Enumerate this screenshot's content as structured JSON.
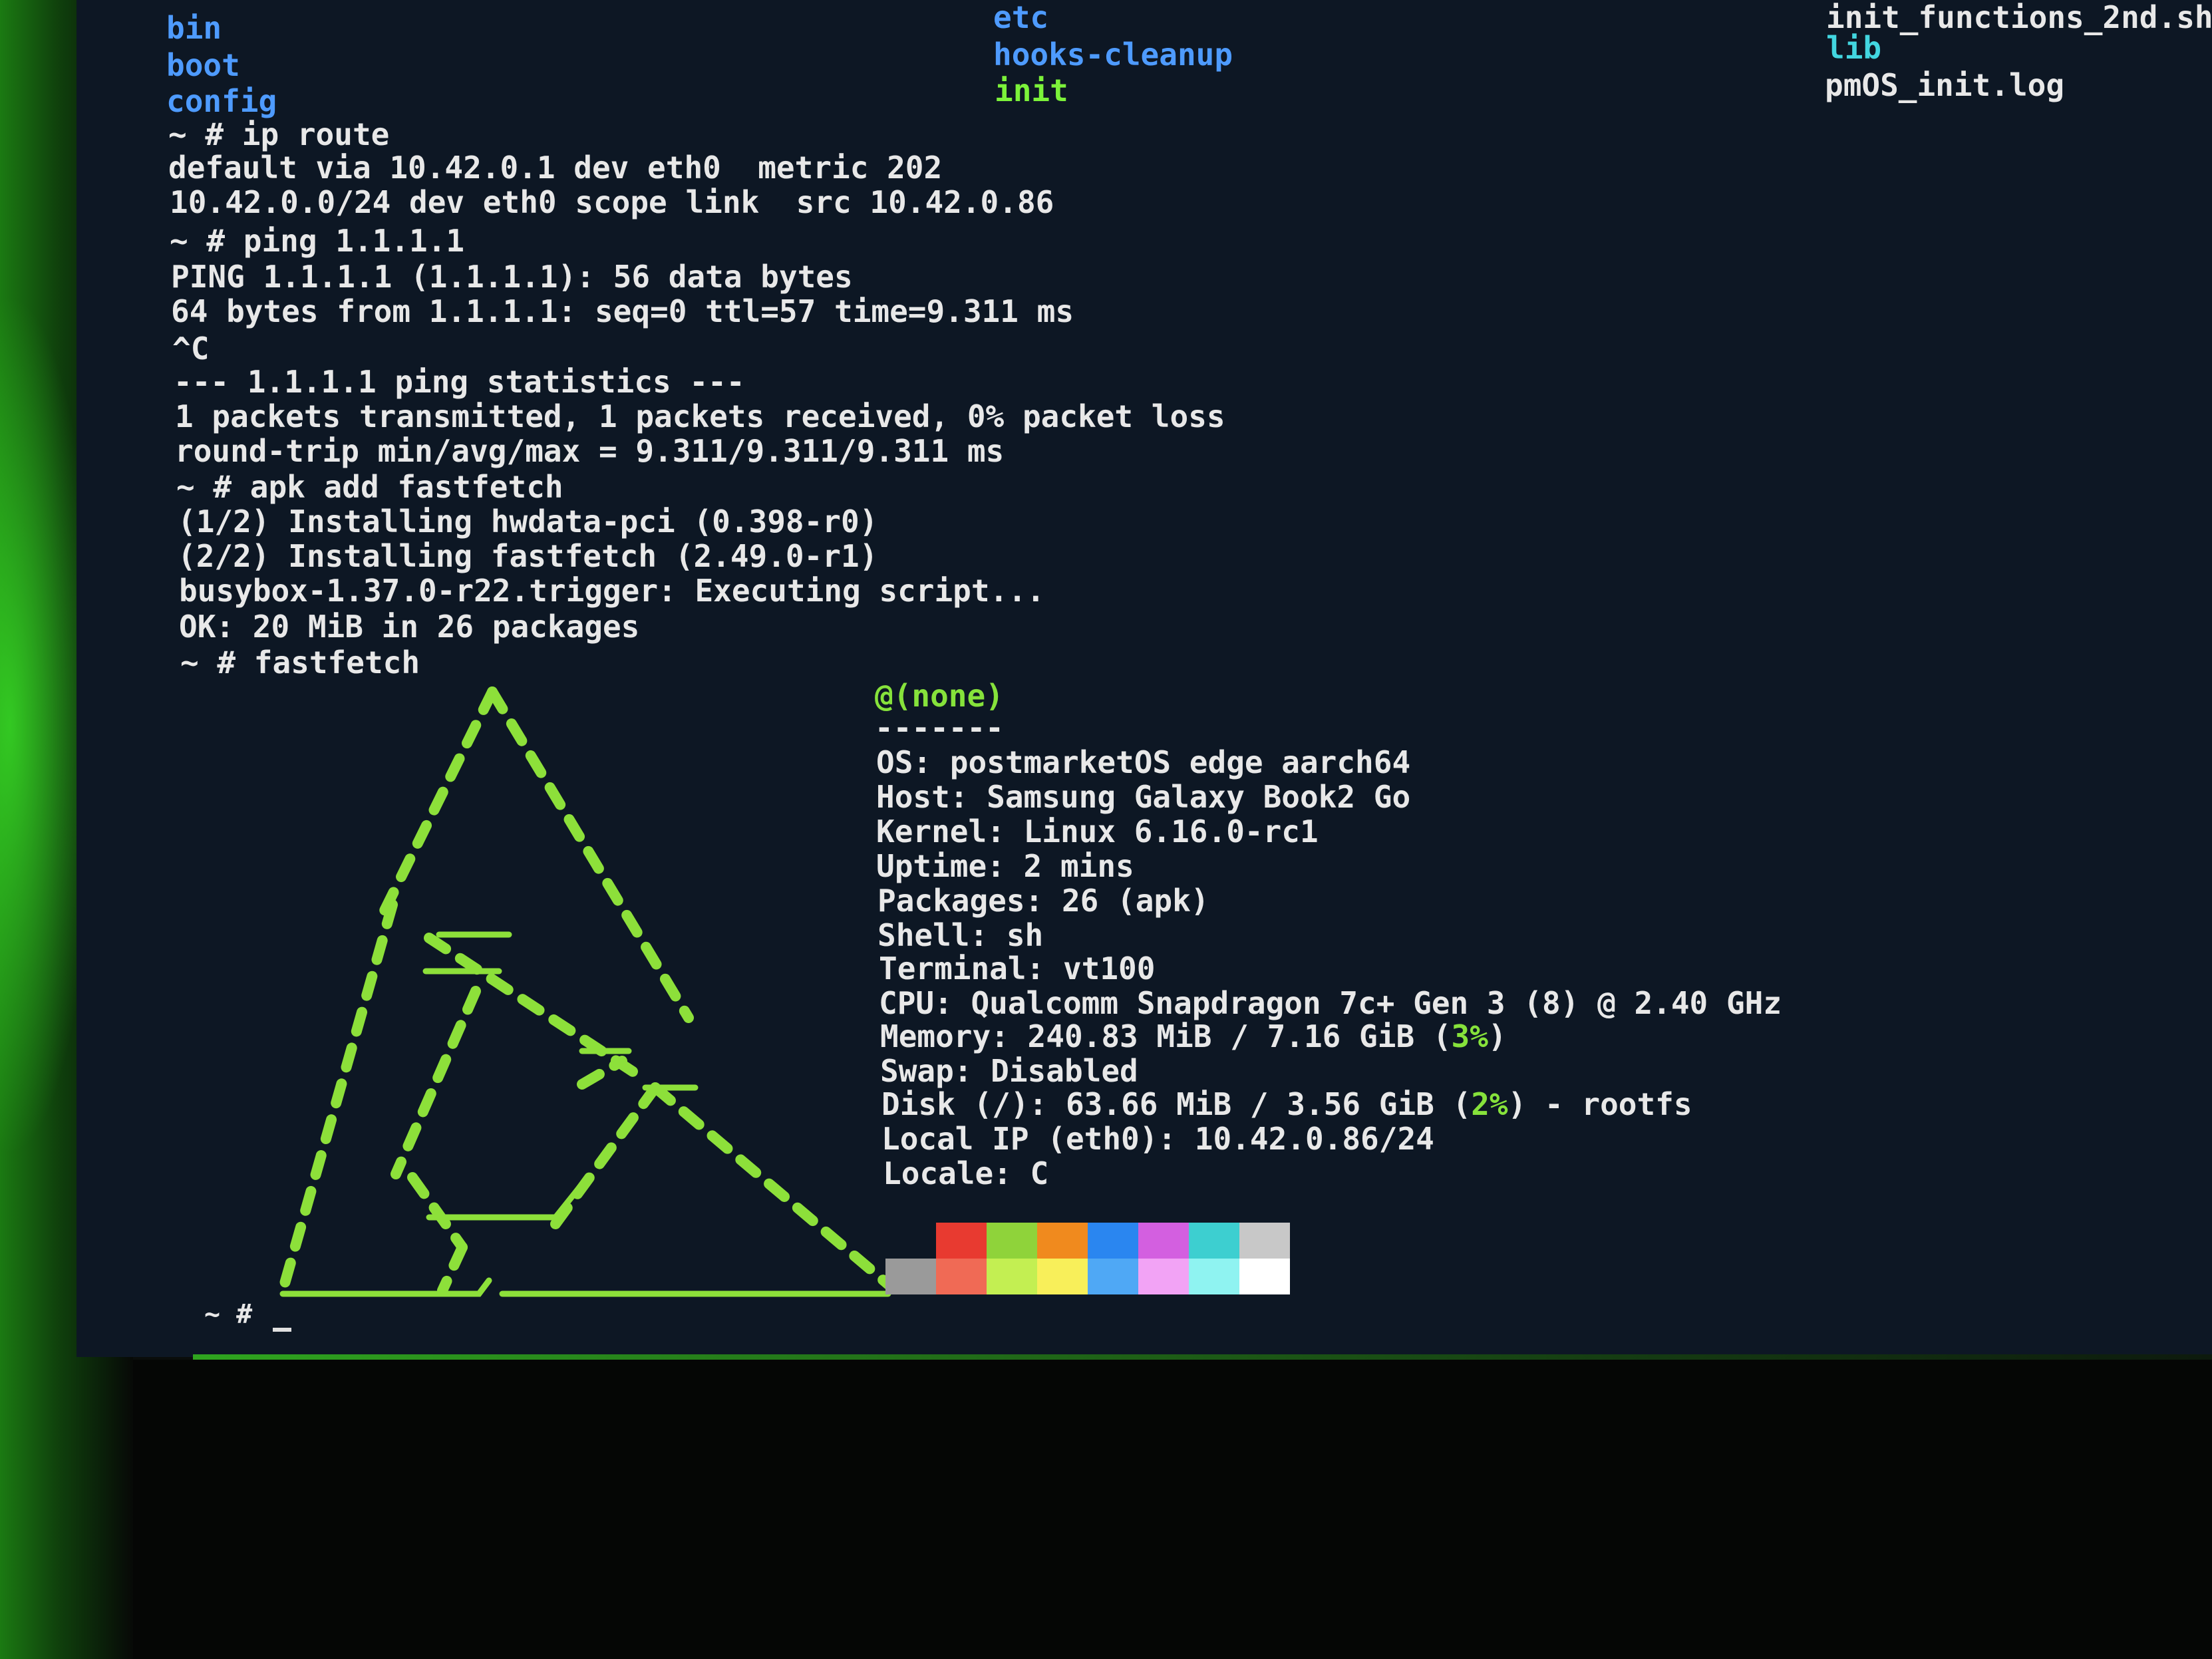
{
  "dir_listing": {
    "col1": [
      {
        "name": "bin",
        "kind": "dir"
      },
      {
        "name": "boot",
        "kind": "dir"
      },
      {
        "name": "config",
        "kind": "dir"
      }
    ],
    "col2": [
      {
        "name": "etc",
        "kind": "dir"
      },
      {
        "name": "hooks-cleanup",
        "kind": "dir"
      },
      {
        "name": "init",
        "kind": "exec"
      }
    ],
    "col3": [
      {
        "name": "init_functions_2nd.sh",
        "kind": "file"
      },
      {
        "name": "lib",
        "kind": "cyan"
      },
      {
        "name": "pmOS_init.log",
        "kind": "file"
      }
    ]
  },
  "terminal_lines": [
    "~ # ip route",
    "default via 10.42.0.1 dev eth0  metric 202",
    "10.42.0.0/24 dev eth0 scope link  src 10.42.0.86",
    "~ # ping 1.1.1.1",
    "PING 1.1.1.1 (1.1.1.1): 56 data bytes",
    "64 bytes from 1.1.1.1: seq=0 ttl=57 time=9.311 ms",
    "^C",
    "--- 1.1.1.1 ping statistics ---",
    "1 packets transmitted, 1 packets received, 0% packet loss",
    "round-trip min/avg/max = 9.311/9.311/9.311 ms",
    "~ # apk add fastfetch",
    "(1/2) Installing hwdata-pci (0.398-r0)",
    "(2/2) Installing fastfetch (2.49.0-r1)",
    "busybox-1.37.0-r22.trigger: Executing script...",
    "OK: 20 MiB in 26 packages",
    "~ # fastfetch"
  ],
  "fastfetch": {
    "user_host": "@(none)",
    "separator": "-------",
    "info": [
      "OS: postmarketOS edge aarch64",
      "Host: Samsung Galaxy Book2 Go",
      "Kernel: Linux 6.16.0-rc1",
      "Uptime: 2 mins",
      "Packages: 26 (apk)",
      "Shell: sh",
      "Terminal: vt100",
      "CPU: Qualcomm Snapdragon 7c+ Gen 3 (8) @ 2.40 GHz"
    ],
    "memory": {
      "pre": "Memory: 240.83 MiB / 7.16 GiB (",
      "pct": "3%",
      "post": ")"
    },
    "swap": "Swap: Disabled",
    "disk": {
      "pre": "Disk (/): 63.66 MiB / 3.56 GiB (",
      "pct": "2%",
      "post": ") - rootfs"
    },
    "local_ip": "Local IP (eth0): 10.42.0.86/24",
    "locale": "Locale: C",
    "palette_top": [
      "#0d1724",
      "#e83a30",
      "#8fd33a",
      "#f08a1e",
      "#2a86f0",
      "#d35fe0",
      "#3dcfd0",
      "#c8c8c8"
    ],
    "palette_bottom": [
      "#9a9a9a",
      "#f06a55",
      "#c3ef52",
      "#f8ef5a",
      "#4fa8f5",
      "#f2a3f5",
      "#8ff3f1",
      "#ffffff"
    ]
  },
  "final_prompt": "~ #",
  "colors": {
    "logo": "#8de03a",
    "dir": "#4e9bff",
    "exec": "#7cf23a",
    "cyan": "#42d6e0"
  }
}
